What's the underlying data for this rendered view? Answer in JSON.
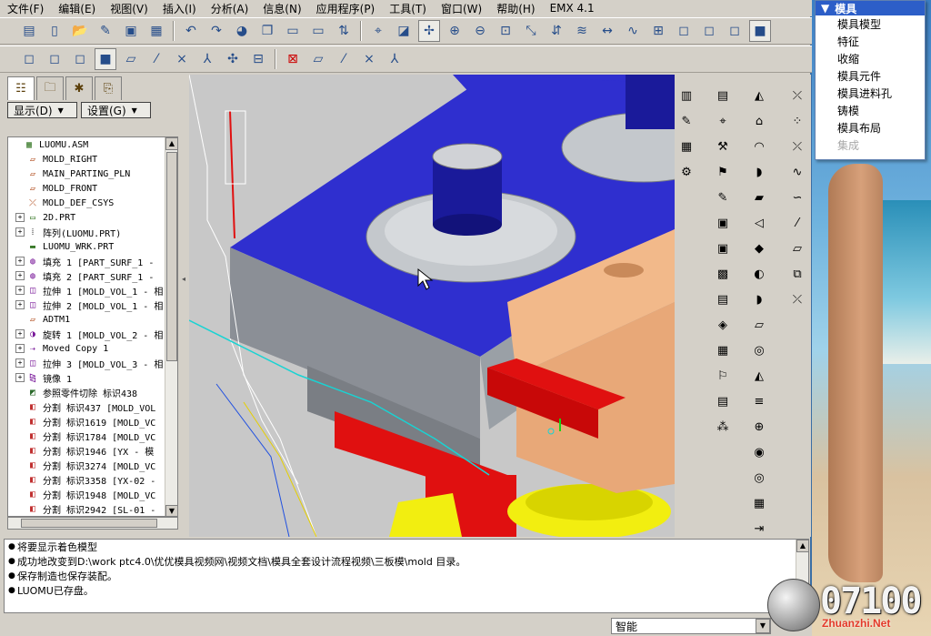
{
  "menubar": {
    "items": [
      "文件(F)",
      "编辑(E)",
      "视图(V)",
      "插入(I)",
      "分析(A)",
      "信息(N)",
      "应用程序(P)",
      "工具(T)",
      "窗口(W)",
      "帮助(H)",
      "EMX 4.1"
    ]
  },
  "panel": {
    "show_label": "显示(D)",
    "settings_label": "设置(G)"
  },
  "tree": {
    "items": [
      {
        "label": "LUOMU.ASM",
        "expander": "",
        "icon": "assembly-icon"
      },
      {
        "label": "MOLD_RIGHT",
        "expander": "",
        "icon": "datum-plane-icon"
      },
      {
        "label": "MAIN_PARTING_PLN",
        "expander": "",
        "icon": "datum-plane-icon"
      },
      {
        "label": "MOLD_FRONT",
        "expander": "",
        "icon": "datum-plane-icon"
      },
      {
        "label": "MOLD_DEF_CSYS",
        "expander": "",
        "icon": "csys-icon"
      },
      {
        "label": "2D.PRT",
        "expander": "+",
        "icon": "part-icon"
      },
      {
        "label": "阵列(LUOMU.PRT)",
        "expander": "+",
        "icon": "pattern-icon"
      },
      {
        "label": "LUOMU_WRK.PRT",
        "expander": "",
        "icon": "workpiece-icon"
      },
      {
        "label": "填充 1 [PART_SURF_1 -",
        "expander": "+",
        "icon": "fill-icon"
      },
      {
        "label": "填充 2 [PART_SURF_1 -",
        "expander": "+",
        "icon": "fill-icon"
      },
      {
        "label": "拉伸 1 [MOLD_VOL_1 - 相",
        "expander": "+",
        "icon": "extrude-icon"
      },
      {
        "label": "拉伸 2 [MOLD_VOL_1 - 相",
        "expander": "+",
        "icon": "extrude-icon"
      },
      {
        "label": "ADTM1",
        "expander": "",
        "icon": "datum-plane-icon"
      },
      {
        "label": "旋转 1 [MOLD_VOL_2 - 相",
        "expander": "+",
        "icon": "revolve-icon"
      },
      {
        "label": "Moved Copy 1",
        "expander": "+",
        "icon": "move-copy-icon"
      },
      {
        "label": "拉伸 3 [MOLD_VOL_3 - 相",
        "expander": "+",
        "icon": "extrude-icon"
      },
      {
        "label": "镜像 1",
        "expander": "+",
        "icon": "mirror-icon"
      },
      {
        "label": "参照零件切除 标识438",
        "expander": "",
        "icon": "ref-cut-icon"
      },
      {
        "label": "分割 标识437 [MOLD_VOL",
        "expander": "",
        "icon": "split-icon"
      },
      {
        "label": "分割 标识1619 [MOLD_VC",
        "expander": "",
        "icon": "split-icon"
      },
      {
        "label": "分割 标识1784 [MOLD_VC",
        "expander": "",
        "icon": "split-icon"
      },
      {
        "label": "分割 标识1946 [YX - 模",
        "expander": "",
        "icon": "split-icon"
      },
      {
        "label": "分割 标识3274 [MOLD_VC",
        "expander": "",
        "icon": "split-icon"
      },
      {
        "label": "分割 标识3358 [YX-02 -",
        "expander": "",
        "icon": "split-icon"
      },
      {
        "label": "分割 标识1948 [MOLD_VC",
        "expander": "",
        "icon": "split-icon"
      },
      {
        "label": "分割 标识2942 [SL-01 -",
        "expander": "",
        "icon": "split-icon"
      }
    ]
  },
  "messages": [
    "将要显示着色模型",
    "成功地改变到D:\\work ptc4.0\\优优模具视频网\\视频文档\\模具全套设计流程视频\\三板模\\mold 目录。",
    "保存制造也保存装配。",
    "LUOMU已存盘。"
  ],
  "status": {
    "filter_value": "智能"
  },
  "mold_menu": {
    "header": "模具",
    "items": [
      "模具模型",
      "特征",
      "收缩",
      "模具元件",
      "模具进料孔",
      "铸模",
      "模具布局"
    ],
    "disabled_item": "集成"
  },
  "watermark": {
    "number": "07100",
    "site": "Zhuanzhi.Net"
  },
  "colors": {
    "mold_plate_top": "#2f2fcf",
    "mold_plate_side": "#8b8f96",
    "slider_red": "#e01010",
    "core_tan": "#f2b98a",
    "gear_yellow": "#f2ee10",
    "boss_blue": "#1a1a9a",
    "menu_header": "#2c5ec8"
  }
}
